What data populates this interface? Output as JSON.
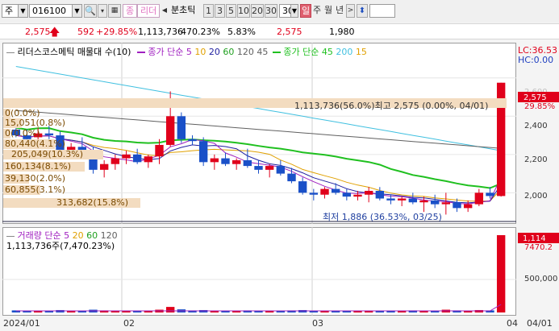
{
  "toolbar": {
    "market": "주",
    "code": "016100",
    "mode_label": "종",
    "stock_name": "리더",
    "chart_period_label": "분초틱",
    "period_buttons": [
      "1",
      "3",
      "5",
      "10",
      "20",
      "30"
    ],
    "period_value": "30",
    "day_label": "일",
    "week_label": "주",
    "month_label": "월",
    "year_label": "년"
  },
  "price_bar": {
    "price": "2,575",
    "change": "592",
    "change_pct": "+29.85%",
    "volume": "1,113,736",
    "volume_pct": "470.23%",
    "turnover": "5.83%",
    "price2": "2,575",
    "prev": "1,980"
  },
  "main_chart": {
    "legend_title": "리더스코스메틱 매물대 수(10)",
    "legend_ma_label": "종가 단순",
    "legend_ma": [
      "5",
      "10",
      "20",
      "60",
      "120",
      "45"
    ],
    "legend_ma2_label": "종가 단순",
    "legend_ma2": [
      "45",
      "200",
      "15"
    ],
    "lc_label": "LC:36.53",
    "hc_label": "HC:0.00",
    "current_price_tag": "2,575",
    "current_pct_tag": "29.85%",
    "price_ticks": [
      "2,600",
      "2,400",
      "2,200",
      "2,000"
    ],
    "top_annotation": "1,113,736(56.0%)최고 2,575 (0.00%, 04/01)",
    "low_annotation": "최저 1,886 (36.53%, 03/25)",
    "volume_profile": [
      {
        "label": "0(0.0%)",
        "w": 0.02
      },
      {
        "label": "15,051(0.8%)",
        "w": 0.05
      },
      {
        "label": "0(0.0%)",
        "w": 0.02
      },
      {
        "label": "80,440(4.1%)",
        "w": 0.14
      },
      {
        "label": "205,049(10.3%)",
        "w": 0.27
      },
      {
        "label": "160,134(8.1%)",
        "w": 0.22
      },
      {
        "label": "39,130(2.0%)",
        "w": 0.07
      },
      {
        "label": "60,855(3.1%)",
        "w": 0.1
      },
      {
        "label": "313,682(15.8%)",
        "w": 0.37
      }
    ]
  },
  "volume_chart": {
    "legend_label": "거래량 단순",
    "legend_ma": [
      "5",
      "20",
      "60",
      "120"
    ],
    "volume_text": "1,113,736주(7,470.23%)",
    "tag_value": "1,114",
    "tag_pct": "7470.2",
    "tick_500k": "500,000"
  },
  "date_axis": [
    "2024/01",
    "02",
    "03",
    "04/01",
    "04"
  ],
  "colors": {
    "up": "#e0001b",
    "down": "#1a50c8",
    "ma5": "#a020c0",
    "ma10": "#e0a000",
    "ma20": "#2020a0",
    "ma60": "#20c020",
    "ma120": "#606060",
    "ma200": "#40c0e0"
  },
  "chart_data": {
    "type": "candlestick",
    "x": [
      "2024/01",
      "02",
      "03",
      "04/01"
    ],
    "ylim": [
      1850,
      2700
    ],
    "candles": [
      {
        "o": 2330,
        "h": 2380,
        "l": 2290,
        "c": 2300
      },
      {
        "o": 2300,
        "h": 2330,
        "l": 2260,
        "c": 2280
      },
      {
        "o": 2290,
        "h": 2340,
        "l": 2250,
        "c": 2310
      },
      {
        "o": 2310,
        "h": 2350,
        "l": 2280,
        "c": 2300
      },
      {
        "o": 2300,
        "h": 2320,
        "l": 2200,
        "c": 2220
      },
      {
        "o": 2220,
        "h": 2260,
        "l": 2180,
        "c": 2240
      },
      {
        "o": 2240,
        "h": 2290,
        "l": 2200,
        "c": 2210
      },
      {
        "o": 2210,
        "h": 2240,
        "l": 2100,
        "c": 2120
      },
      {
        "o": 2120,
        "h": 2170,
        "l": 2080,
        "c": 2150
      },
      {
        "o": 2150,
        "h": 2200,
        "l": 2120,
        "c": 2180
      },
      {
        "o": 2180,
        "h": 2220,
        "l": 2150,
        "c": 2200
      },
      {
        "o": 2200,
        "h": 2230,
        "l": 2150,
        "c": 2160
      },
      {
        "o": 2160,
        "h": 2200,
        "l": 2130,
        "c": 2190
      },
      {
        "o": 2190,
        "h": 2280,
        "l": 2150,
        "c": 2250
      },
      {
        "o": 2250,
        "h": 2530,
        "l": 2240,
        "c": 2400
      },
      {
        "o": 2400,
        "h": 2420,
        "l": 2260,
        "c": 2280
      },
      {
        "o": 2280,
        "h": 2300,
        "l": 2250,
        "c": 2270
      },
      {
        "o": 2270,
        "h": 2290,
        "l": 2140,
        "c": 2160
      },
      {
        "o": 2160,
        "h": 2200,
        "l": 2120,
        "c": 2180
      },
      {
        "o": 2180,
        "h": 2210,
        "l": 2140,
        "c": 2150
      },
      {
        "o": 2150,
        "h": 2180,
        "l": 2120,
        "c": 2170
      },
      {
        "o": 2170,
        "h": 2230,
        "l": 2130,
        "c": 2140
      },
      {
        "o": 2140,
        "h": 2170,
        "l": 2100,
        "c": 2120
      },
      {
        "o": 2120,
        "h": 2150,
        "l": 2080,
        "c": 2140
      },
      {
        "o": 2140,
        "h": 2170,
        "l": 2090,
        "c": 2100
      },
      {
        "o": 2100,
        "h": 2130,
        "l": 2050,
        "c": 2060
      },
      {
        "o": 2060,
        "h": 2080,
        "l": 1990,
        "c": 2000
      },
      {
        "o": 2000,
        "h": 2020,
        "l": 1960,
        "c": 1990
      },
      {
        "o": 1990,
        "h": 2030,
        "l": 1970,
        "c": 2020
      },
      {
        "o": 2020,
        "h": 2050,
        "l": 1990,
        "c": 2000
      },
      {
        "o": 2000,
        "h": 2020,
        "l": 1960,
        "c": 1980
      },
      {
        "o": 1980,
        "h": 2010,
        "l": 1960,
        "c": 1990
      },
      {
        "o": 1990,
        "h": 2030,
        "l": 1950,
        "c": 2010
      },
      {
        "o": 2010,
        "h": 2030,
        "l": 1960,
        "c": 1970
      },
      {
        "o": 1970,
        "h": 1990,
        "l": 1940,
        "c": 1960
      },
      {
        "o": 1960,
        "h": 1980,
        "l": 1930,
        "c": 1970
      },
      {
        "o": 1970,
        "h": 2000,
        "l": 1940,
        "c": 1950
      },
      {
        "o": 1950,
        "h": 1980,
        "l": 1900,
        "c": 1960
      },
      {
        "o": 1960,
        "h": 1990,
        "l": 1920,
        "c": 1940
      },
      {
        "o": 1940,
        "h": 2000,
        "l": 1886,
        "c": 1950
      },
      {
        "o": 1950,
        "h": 1970,
        "l": 1900,
        "c": 1920
      },
      {
        "o": 1920,
        "h": 1960,
        "l": 1900,
        "c": 1940
      },
      {
        "o": 1940,
        "h": 2020,
        "l": 1930,
        "c": 2000
      },
      {
        "o": 2000,
        "h": 2030,
        "l": 1970,
        "c": 1983
      },
      {
        "o": 1983,
        "h": 2575,
        "l": 1980,
        "c": 2575
      }
    ],
    "volumes": [
      30,
      25,
      20,
      22,
      35,
      28,
      26,
      40,
      30,
      25,
      20,
      24,
      28,
      40,
      80,
      45,
      30,
      35,
      28,
      25,
      22,
      30,
      26,
      24,
      25,
      30,
      35,
      28,
      26,
      22,
      20,
      25,
      24,
      28,
      26,
      22,
      30,
      25,
      24,
      40,
      30,
      28,
      35,
      30,
      1114
    ]
  }
}
